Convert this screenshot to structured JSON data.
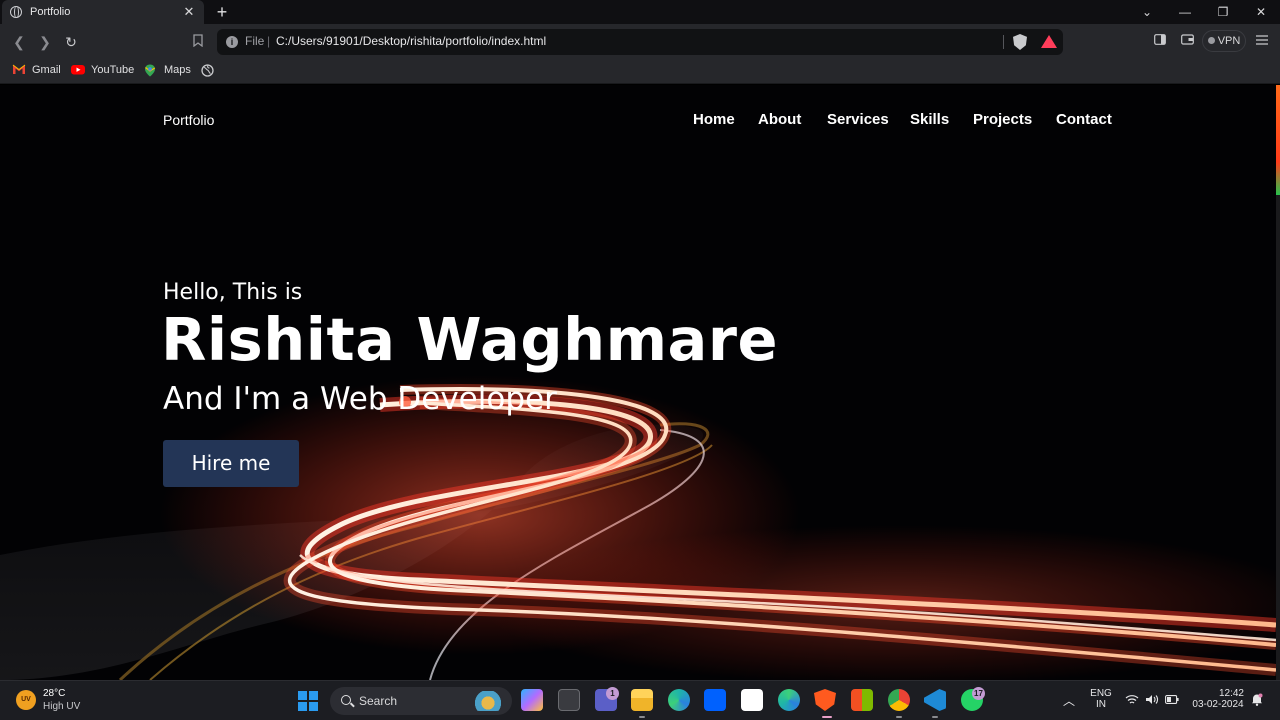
{
  "browser": {
    "tab_title": "Portfolio",
    "tab_close": "✕",
    "new_tab": "+",
    "window_controls": [
      "⌄",
      "—",
      "❐",
      "✕"
    ],
    "address": {
      "scheme_label": "File",
      "separator": "|",
      "url": "C:/Users/91901/Desktop/rishita/portfolio/index.html"
    },
    "vpn_label": "VPN",
    "bookmarks": [
      {
        "label": "Gmail",
        "icon": "gmail-icon"
      },
      {
        "label": "YouTube",
        "icon": "youtube-icon"
      },
      {
        "label": "Maps",
        "icon": "maps-icon"
      },
      {
        "label": "",
        "icon": "globe-icon"
      }
    ]
  },
  "site": {
    "brand": "Portfolio",
    "nav": [
      "Home",
      "About",
      "Services",
      "Skills",
      "Projects",
      "Contact"
    ],
    "hero": {
      "greeting": "Hello, This is",
      "name": "Rishita Waghmare",
      "role": "And I'm a Web Developer",
      "cta": "Hire me"
    },
    "colors": {
      "cta_background": "#233556",
      "text": "#ffffff",
      "background": "#020204"
    }
  },
  "taskbar": {
    "weather": {
      "temp": "28°C",
      "desc": "High UV",
      "icon_text": "UV"
    },
    "search_label": "Search",
    "badges": {
      "teams": "1",
      "whatsapp": "17"
    },
    "language": {
      "line1": "ENG",
      "line2": "IN"
    },
    "clock": {
      "time": "12:42",
      "date": "03-02-2024"
    }
  }
}
